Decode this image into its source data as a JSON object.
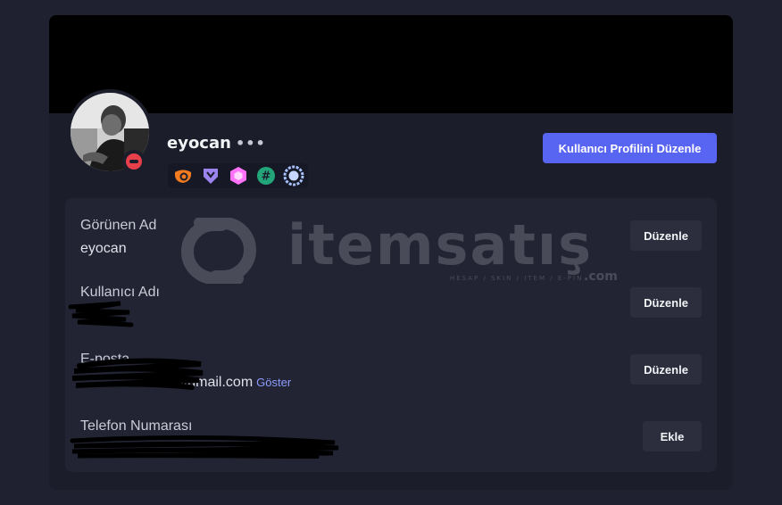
{
  "profile": {
    "username": "eyocan",
    "more_label": "•••",
    "status": "dnd",
    "edit_profile_label": "Kullanıcı Profilini Düzenle",
    "badges": [
      "hypesquad-brilliance-icon",
      "hypesquad-bravery-icon",
      "nitro-boost-icon",
      "hashtag-icon",
      "quest-laurel-icon"
    ]
  },
  "fields": [
    {
      "label": "Görünen Ad",
      "value": "eyocan",
      "button": "Düzenle"
    },
    {
      "label": "Kullanıcı Adı",
      "value": "",
      "button": "Düzenle"
    },
    {
      "label": "E-posta",
      "value": "@gmail.com",
      "reveal_label": "Göster",
      "button": "Düzenle"
    },
    {
      "label": "Telefon Numarası",
      "value": "",
      "button": "Ekle"
    }
  ],
  "watermark": {
    "brand": "itemsatış",
    "tagline": "HESAP / SKIN / ITEM / E-PIN",
    "suffix": ".com"
  },
  "colors": {
    "accent": "#5865f2",
    "dnd": "#e8404a",
    "link": "#8e9cff"
  }
}
